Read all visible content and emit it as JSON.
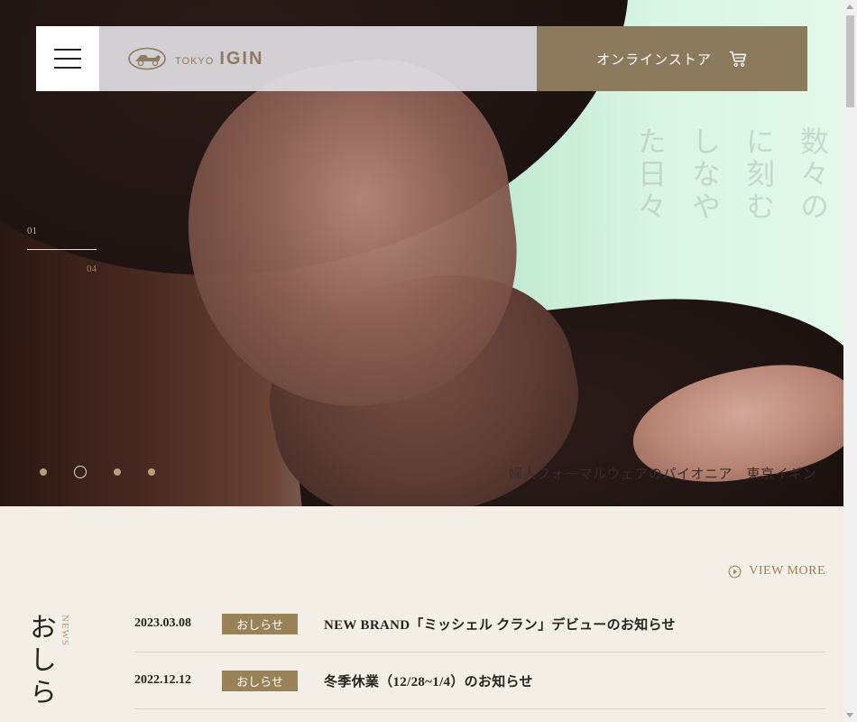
{
  "header": {
    "logo_small": "TOKYO",
    "logo_big": "IGIN",
    "store_label": "オンラインストア"
  },
  "hero": {
    "counter_current": "01",
    "counter_total": "04",
    "vertical_lines": [
      "数々の",
      "に刻む",
      "しなや",
      "た日々"
    ],
    "tagline": "婦人フォーマルウェアのパイオニア　東京イギン",
    "slides_total": 4,
    "slide_active": 2
  },
  "news": {
    "title_jp": "おしら",
    "title_en": "NEWS",
    "view_more": "VIEW MORE",
    "items": [
      {
        "date": "2023.03.08",
        "badge": "おしらせ",
        "text": "NEW BRAND「ミッシェル クラン」デビューのお知らせ"
      },
      {
        "date": "2022.12.12",
        "badge": "おしらせ",
        "text": "冬季休業（12/28~1/4）のお知らせ"
      }
    ]
  },
  "colors": {
    "accent": "#8b7a5c",
    "badge": "#9a8258",
    "background": "#f3eee6"
  }
}
